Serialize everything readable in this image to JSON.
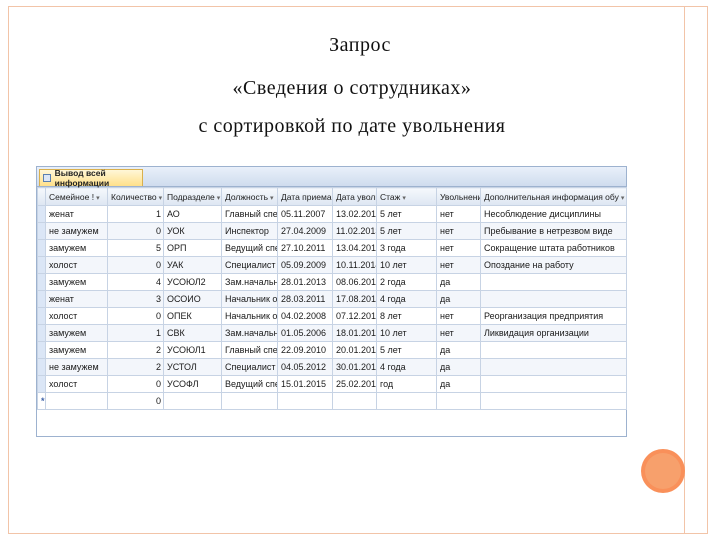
{
  "slide": {
    "title_line1": "Запрос",
    "title_line2": "«Сведения о сотрудниках»",
    "title_line3": "с сортировкой по дате увольнения"
  },
  "window": {
    "tab_label": "Вывод всей информации",
    "columns": [
      "Семейное !",
      "Количество",
      "Подразделе",
      "Должность",
      "Дата приема",
      "Дата увольн",
      "Стаж",
      "Увольнение",
      "Дополнительная информация обу"
    ],
    "rows": [
      [
        "женат",
        "1",
        "АО",
        "Главный спец",
        "05.11.2007",
        "13.02.2013",
        "5 лет",
        "нет",
        "Несоблюдение дисциплины"
      ],
      [
        "не замужем",
        "0",
        "УОК",
        "Инспектор",
        "27.04.2009",
        "11.02.2013",
        "5 лет",
        "нет",
        "Пребывание в нетрезвом виде"
      ],
      [
        "замужем",
        "5",
        "ОРП",
        "Ведущий спец",
        "27.10.2011",
        "13.04.2014",
        "3 года",
        "нет",
        "Сокращение штата работников"
      ],
      [
        "холост",
        "0",
        "УАК",
        "Специалист",
        "05.09.2009",
        "10.11.2014",
        "10 лет",
        "нет",
        "Опоздание на работу"
      ],
      [
        "замужем",
        "4",
        "УСОЮЛ2",
        "Зам.начальни",
        "28.01.2013",
        "08.06.2015",
        "2 года",
        "да",
        ""
      ],
      [
        "женат",
        "3",
        "ОСОИО",
        "Начальник отд",
        "28.03.2011",
        "17.08.2015",
        "4 года",
        "да",
        ""
      ],
      [
        "холост",
        "0",
        "ОПЕК",
        "Начальник отд",
        "04.02.2008",
        "07.12.2015",
        "8 лет",
        "нет",
        "Реорганизация предприятия"
      ],
      [
        "замужем",
        "1",
        "СВК",
        "Зам.начальни",
        "01.05.2006",
        "18.01.2015",
        "10 лет",
        "нет",
        "Ликвидация организации"
      ],
      [
        "замужем",
        "2",
        "УСОЮЛ1",
        "Главный спец",
        "22.09.2010",
        "20.01.2015",
        "5 лет",
        "да",
        ""
      ],
      [
        "не замужем",
        "2",
        "УСТОЛ",
        "Специалист",
        "04.05.2012",
        "30.01.2015",
        "4 года",
        "да",
        ""
      ],
      [
        "холост",
        "0",
        "УСОФЛ",
        "Ведущий спец",
        "15.01.2015",
        "25.02.2015",
        "год",
        "да",
        ""
      ]
    ],
    "new_row": {
      "marker": "*",
      "default_value": "0"
    }
  }
}
